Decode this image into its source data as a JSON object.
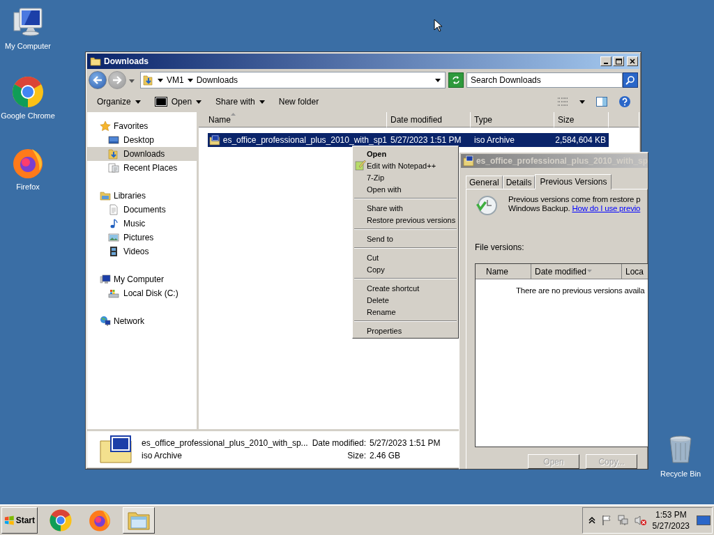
{
  "desktop_icons": [
    {
      "label": "My Computer",
      "kind": "computer"
    },
    {
      "label": "Google Chrome",
      "kind": "chrome"
    },
    {
      "label": "Firefox",
      "kind": "firefox"
    },
    {
      "label": "Recycle Bin",
      "kind": "recycle"
    }
  ],
  "explorer": {
    "title": "Downloads",
    "breadcrumb": [
      "VM1",
      "Downloads"
    ],
    "search": {
      "placeholder": "Search Downloads"
    },
    "toolbar": [
      {
        "label": "Organize",
        "kind": "menu"
      },
      {
        "label": "Open",
        "kind": "zip-menu"
      },
      {
        "label": "Share with",
        "kind": "menu"
      },
      {
        "label": "New folder",
        "kind": "plain"
      }
    ],
    "sidebar": [
      {
        "label": "Favorites",
        "kind": "star",
        "selected": false,
        "children": [
          {
            "label": "Desktop",
            "kind": "desktop",
            "selected": false
          },
          {
            "label": "Downloads",
            "kind": "downloads",
            "selected": true
          },
          {
            "label": "Recent Places",
            "kind": "recent",
            "selected": false
          }
        ]
      },
      {
        "label": "Libraries",
        "kind": "library",
        "selected": false,
        "children": [
          {
            "label": "Documents",
            "kind": "document",
            "selected": false
          },
          {
            "label": "Music",
            "kind": "music",
            "selected": false
          },
          {
            "label": "Pictures",
            "kind": "pictures",
            "selected": false
          },
          {
            "label": "Videos",
            "kind": "videos",
            "selected": false
          }
        ]
      },
      {
        "label": "My Computer",
        "kind": "computer",
        "selected": false,
        "children": [
          {
            "label": "Local Disk (C:)",
            "kind": "disk",
            "selected": false
          }
        ]
      },
      {
        "label": "Network",
        "kind": "network",
        "selected": false
      }
    ],
    "columns": [
      {
        "label": "Name",
        "sorted": true
      },
      {
        "label": "Date modified",
        "sorted": false
      },
      {
        "label": "Type",
        "sorted": false
      },
      {
        "label": "Size",
        "sorted": false
      }
    ],
    "files": [
      {
        "name": "es_office_professional_plus_2010_with_sp1",
        "date": "5/27/2023 1:51 PM",
        "type": "iso Archive",
        "size": "2,584,604 KB",
        "selected": true
      }
    ],
    "details": {
      "name": "es_office_professional_plus_2010_with_sp...",
      "type": "iso Archive",
      "fields": [
        {
          "label": "Date modified:",
          "value": "5/27/2023 1:51 PM"
        },
        {
          "label": "Size:",
          "value": "2.46 GB"
        }
      ]
    }
  },
  "context_menu": {
    "groups": [
      [
        {
          "label": "Open",
          "default": true,
          "kind": "plain"
        },
        {
          "label": "Edit with Notepad++",
          "default": false,
          "kind": "notepad"
        },
        {
          "label": "7-Zip",
          "default": false,
          "kind": "plain"
        },
        {
          "label": "Open with",
          "default": false,
          "kind": "plain"
        }
      ],
      [
        {
          "label": "Share with",
          "default": false,
          "kind": "plain"
        },
        {
          "label": "Restore previous versions",
          "default": false,
          "kind": "plain"
        }
      ],
      [
        {
          "label": "Send to",
          "default": false,
          "kind": "plain"
        }
      ],
      [
        {
          "label": "Cut",
          "default": false,
          "kind": "plain"
        },
        {
          "label": "Copy",
          "default": false,
          "kind": "plain"
        }
      ],
      [
        {
          "label": "Create shortcut",
          "default": false,
          "kind": "plain"
        },
        {
          "label": "Delete",
          "default": false,
          "kind": "plain"
        },
        {
          "label": "Rename",
          "default": false,
          "kind": "plain"
        }
      ],
      [
        {
          "label": "Properties",
          "default": false,
          "kind": "plain"
        }
      ]
    ]
  },
  "properties": {
    "title": "es_office_professional_plus_2010_with_sp",
    "tabs": [
      {
        "label": "General",
        "selected": false
      },
      {
        "label": "Details",
        "selected": false
      },
      {
        "label": "Previous Versions",
        "selected": true
      }
    ],
    "info": [
      "Previous versions come from restore p",
      "Windows Backup."
    ],
    "link": "How do I use previo",
    "list_label": "File versions:",
    "columns": [
      {
        "label": "Name",
        "sorted": false
      },
      {
        "label": "Date modified",
        "sorted": true
      },
      {
        "label": "Loca",
        "sorted": false
      }
    ],
    "empty_text": "There are no previous versions availa",
    "buttons": [
      {
        "label": "Open",
        "disabled": true
      },
      {
        "label": "Copy...",
        "disabled": true
      }
    ]
  },
  "taskbar": {
    "start": "Start",
    "apps": [
      {
        "kind": "chrome",
        "selected": false
      },
      {
        "kind": "firefox",
        "selected": false
      },
      {
        "kind": "explorer",
        "selected": true
      }
    ],
    "tray": [
      {
        "kind": "chevron"
      },
      {
        "kind": "flag"
      },
      {
        "kind": "network"
      },
      {
        "kind": "volume-muted"
      }
    ],
    "time": "1:53 PM",
    "date": "5/27/2023"
  }
}
